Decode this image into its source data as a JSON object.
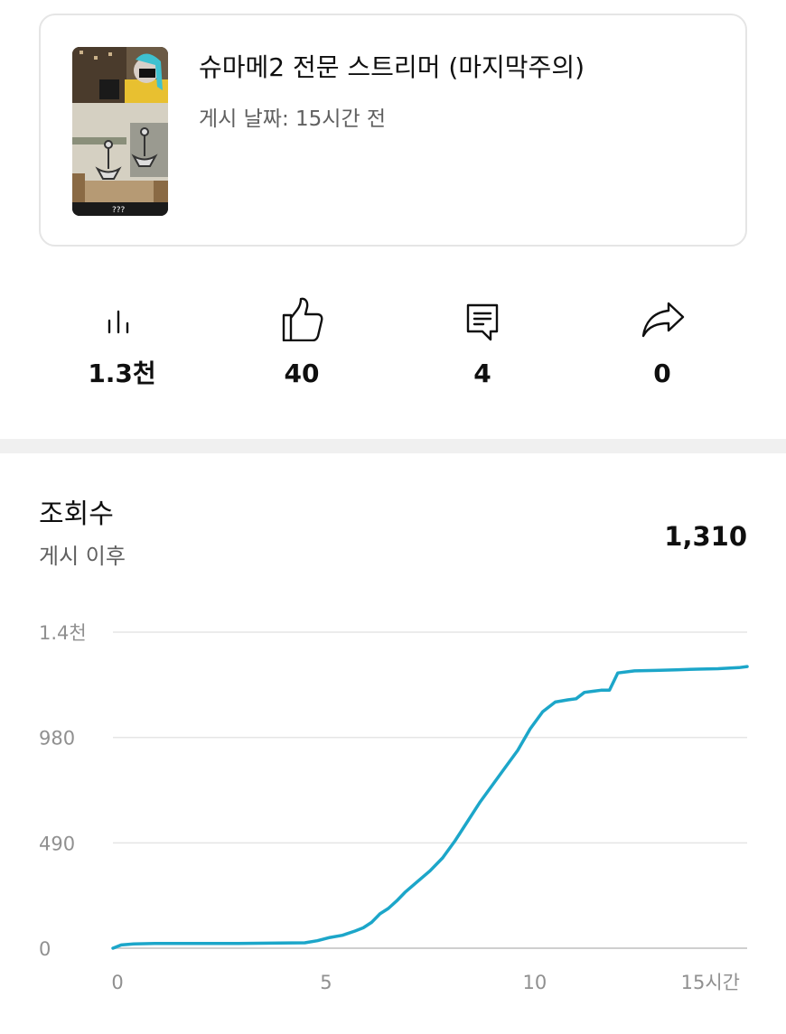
{
  "video": {
    "title": "슈마메2 전문 스트리머 (마지막주의)",
    "published": "게시 날짜: 15시간 전",
    "thumbnail_caption": "???"
  },
  "stats": [
    {
      "icon": "bar-chart-icon",
      "value": "1.3천"
    },
    {
      "icon": "thumbs-up-icon",
      "value": "40"
    },
    {
      "icon": "comment-icon",
      "value": "4"
    },
    {
      "icon": "share-icon",
      "value": "0"
    }
  ],
  "metric": {
    "title": "조회수",
    "subtitle": "게시 이후",
    "total": "1,310"
  },
  "colors": {
    "line": "#1ca6c9",
    "grid": "#e5e5e5",
    "axis_text": "#909090"
  },
  "chart_data": {
    "type": "line",
    "title": "",
    "xlabel": "",
    "ylabel": "",
    "x_ticks": [
      "0",
      "5",
      "10",
      "15시간"
    ],
    "x_tick_values": [
      0,
      5,
      10,
      15
    ],
    "y_ticks": [
      "0",
      "490",
      "980",
      "1.4천"
    ],
    "y_tick_values": [
      0,
      490,
      980,
      1470
    ],
    "xlim": [
      0,
      15.2
    ],
    "ylim": [
      0,
      1470
    ],
    "grid": true,
    "series": [
      {
        "x": [
          0,
          0.2,
          0.5,
          1,
          2,
          3,
          3.5,
          4,
          4.6,
          4.9,
          5.2,
          5.5,
          5.8,
          6.0,
          6.2,
          6.4,
          6.6,
          6.8,
          7.0,
          7.3,
          7.6,
          7.9,
          8.2,
          8.5,
          8.8,
          9.1,
          9.4,
          9.7,
          10.0,
          10.3,
          10.6,
          10.9,
          11.1,
          11.3,
          11.5,
          11.7,
          11.9,
          12.1,
          12.5,
          13,
          13.5,
          14,
          14.5,
          15,
          15.2
        ],
        "y": [
          0,
          15,
          20,
          22,
          22,
          22,
          23,
          24,
          25,
          35,
          50,
          60,
          80,
          95,
          120,
          160,
          185,
          220,
          260,
          310,
          360,
          420,
          500,
          590,
          680,
          760,
          840,
          920,
          1020,
          1100,
          1145,
          1155,
          1160,
          1190,
          1195,
          1200,
          1200,
          1280,
          1290,
          1292,
          1295,
          1298,
          1300,
          1305,
          1310
        ]
      }
    ]
  }
}
